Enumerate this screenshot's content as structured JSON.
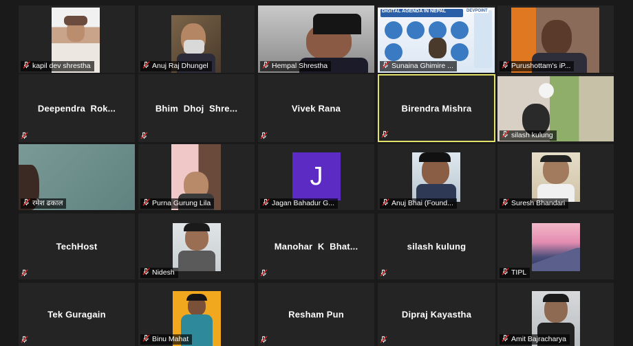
{
  "tiles": [
    {
      "name": "kapil dev shrestha",
      "mode": "video"
    },
    {
      "name": "Anuj Raj Dhungel",
      "mode": "video"
    },
    {
      "name": "Hempal Shrestha",
      "mode": "video"
    },
    {
      "name": "Sunaina Ghimire ...",
      "mode": "video",
      "screen": {
        "title": "DIGITAL AGENDA IN NEPAL",
        "brand": "DEVPOINT"
      }
    },
    {
      "name": "Purushottam's iP...",
      "mode": "video"
    },
    {
      "name": "Deependra  Rok...",
      "mode": "name"
    },
    {
      "name": "Bhim  Dhoj  Shre...",
      "mode": "name"
    },
    {
      "name": "Vivek Rana",
      "mode": "name"
    },
    {
      "name": "Birendra Mishra",
      "mode": "name",
      "active": true
    },
    {
      "name": "silash kulung",
      "mode": "video"
    },
    {
      "name": "रमेश ढकाल",
      "mode": "video"
    },
    {
      "name": "Purna Gurung Lila",
      "mode": "video"
    },
    {
      "name": "Jagan Bahadur G...",
      "mode": "avatar",
      "initial": "J"
    },
    {
      "name": "Anuj Bhai (Found...",
      "mode": "video"
    },
    {
      "name": "Suresh Bhandari",
      "mode": "video"
    },
    {
      "name": "TechHost",
      "mode": "name"
    },
    {
      "name": "Nidesh",
      "mode": "video"
    },
    {
      "name": "Manohar  K  Bhat...",
      "mode": "name"
    },
    {
      "name": "silash kulung",
      "mode": "name"
    },
    {
      "name": "TIPL",
      "mode": "video"
    },
    {
      "name": "Tek Guragain",
      "mode": "name"
    },
    {
      "name": "Binu Mahat",
      "mode": "video"
    },
    {
      "name": "Resham Pun",
      "mode": "name"
    },
    {
      "name": "Dipraj Kayastha",
      "mode": "name"
    },
    {
      "name": "Amit Bajracharya",
      "mode": "video"
    }
  ],
  "colors": {
    "active_border": "#e3e36b",
    "muted_icon": "#e02828",
    "avatar_bg": "#5b2bc4"
  }
}
